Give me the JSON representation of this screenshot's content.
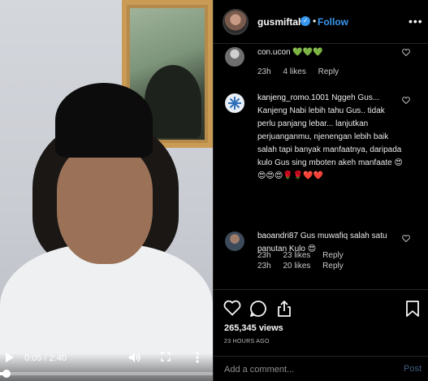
{
  "video": {
    "time": "0:05 / 2:40",
    "progress": 0.03
  },
  "header": {
    "username": "gusmiftah",
    "verified_mark": "✓",
    "separator": "•",
    "follow_label": "Follow",
    "more_label": "•••"
  },
  "comments": [
    {
      "avatar_icon": "user-avatar",
      "username": "",
      "text": "con.ucon 💚💚💚",
      "time": "23h",
      "likes": "4 likes",
      "reply": "Reply"
    },
    {
      "avatar_icon": "snowflake-avatar",
      "username": "kanjeng_romo.1001",
      "text": "Nggeh Gus... Kanjeng Nabi lebih tahu Gus.. tidak perlu panjang lebar... lanjutkan perjuanganmu, njenengan lebih baik salah tapi banyak manfaatnya, daripada kulo Gus sing mboten akeh manfaate 😍😍😍😍🌹🌹❤️❤️",
      "time": "23h",
      "likes": "23 likes",
      "reply": "Reply"
    },
    {
      "avatar_icon": "user-avatar",
      "username": "baoandri87",
      "text": "Gus muwafiq salah satu panutan Kulo 😍",
      "time": "23h",
      "likes": "20 likes",
      "reply": "Reply"
    }
  ],
  "actions": {
    "views": "265,345 views",
    "time_ago": "23 HOURS AGO"
  },
  "add_comment": {
    "placeholder": "Add a comment...",
    "post_label": "Post"
  },
  "colors": {
    "accent": "#3897f0",
    "post_disabled": "#3f5c7e",
    "background": "#000000"
  }
}
